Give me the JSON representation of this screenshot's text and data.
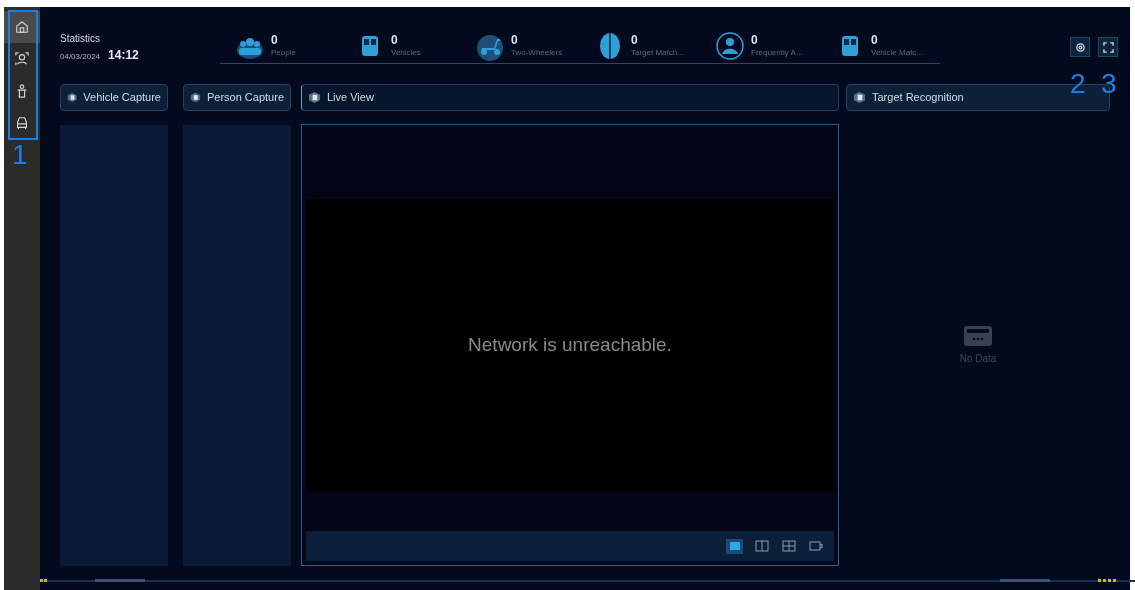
{
  "sidebar": {
    "items": [
      {
        "kind": "home",
        "selected": true
      },
      {
        "kind": "face",
        "selected": false
      },
      {
        "kind": "person",
        "selected": false
      },
      {
        "kind": "car",
        "selected": false
      }
    ]
  },
  "header": {
    "title": "Statistics",
    "date": "04/03/2024",
    "time": "14:12"
  },
  "stats": [
    {
      "kind": "people",
      "value": "0",
      "label": "People"
    },
    {
      "kind": "vehicle",
      "value": "0",
      "label": "Vehicles"
    },
    {
      "kind": "scooter",
      "value": "0",
      "label": "Two-Wheelers"
    },
    {
      "kind": "shield",
      "value": "0",
      "label": "Target Match..."
    },
    {
      "kind": "user",
      "value": "0",
      "label": "Frequently A..."
    },
    {
      "kind": "vehicle",
      "value": "0",
      "label": "Vehicle Matc..."
    }
  ],
  "panels": {
    "vehicle_capture": "Vehicle Capture",
    "person_capture": "Person Capture",
    "live_view": {
      "title": "Live View",
      "message": "Network is unreachable.",
      "layouts": [
        {
          "kind": "single",
          "selected": true
        },
        {
          "kind": "split2",
          "selected": false
        },
        {
          "kind": "split4",
          "selected": false
        },
        {
          "kind": "camera",
          "selected": false
        }
      ]
    },
    "target_recognition": {
      "title": "Target Recognition",
      "empty": "No Data"
    }
  },
  "annotations": [
    "1",
    "2",
    "3"
  ]
}
